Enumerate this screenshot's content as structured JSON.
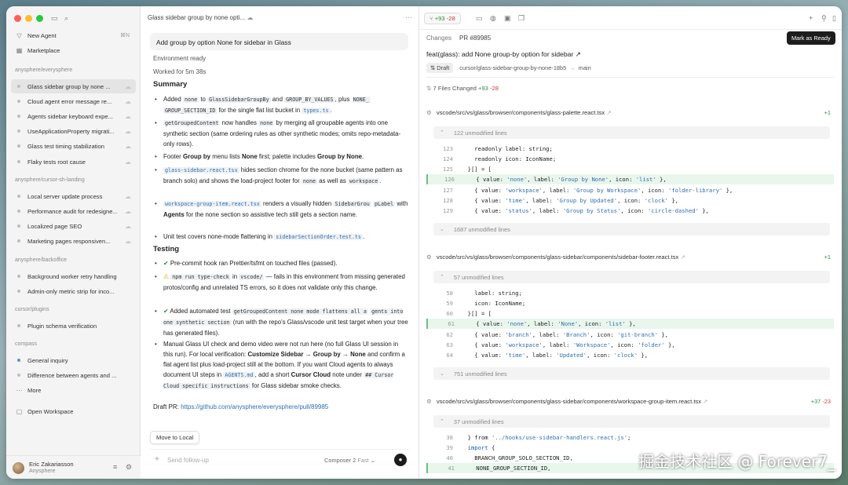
{
  "sidebar": {
    "top": [
      {
        "label": "New Agent",
        "shortcut": "⌘N",
        "icon": "new-agent-icon",
        "glyph": "▽"
      },
      {
        "label": "Marketplace",
        "icon": "marketplace-icon",
        "glyph": "▦"
      }
    ],
    "group1": {
      "name": "anysphere/everysphere",
      "items": [
        "Glass sidebar group by none ...",
        "Cloud agent error message re...",
        "Agents sidebar keyboard expe...",
        "UseApplicationProperty migrati...",
        "Glass test timing stabilization",
        "Flaky tests root cause"
      ]
    },
    "group2": {
      "name": "anysphere/cursor-sh-landing",
      "items": [
        "Local server update process",
        "Performance audit for redesigne...",
        "Localized page SEO",
        "Marketing pages responsiven..."
      ]
    },
    "group3": {
      "name": "anysphere/backoffice",
      "items": [
        "Background worker retry handling",
        "Admin-only metric strip for inco..."
      ]
    },
    "group4": {
      "name": "cursor/plugins",
      "items": [
        "Plugin schema verification"
      ]
    },
    "group5": {
      "name": "compass",
      "items": [
        "General inquiry",
        "Difference between agents and ..."
      ]
    },
    "more": "More",
    "open_workspace": "Open Workspace",
    "user": {
      "name": "Eric Zakariasson",
      "org": "Anysphere"
    }
  },
  "chat": {
    "title": "Glass sidebar group by none opti...",
    "prompt": "Add group by option None for sidebar in Glass",
    "env": "Environment ready",
    "worked": "Worked for 5m 38s",
    "summary_h": "Summary",
    "testing_h": "Testing",
    "draft_label": "Draft PR:",
    "draft_link": "https://github.com/anysphere/everysphere/pull/89985",
    "move_local": "Move to Local",
    "followup": "Send follow-up",
    "model": "Composer 2",
    "speed": "Fast"
  },
  "right": {
    "diff_add": "+93",
    "diff_del": "-28",
    "mark_ready": "Mark as Ready",
    "tab_changes": "Changes",
    "tab_pr": "PR #89985",
    "pr_title": "feat(glass): add None group-by option for sidebar ↗",
    "draft": "Draft",
    "branch": "cursor/glass-sidebar-group-by-none-18b5",
    "base": "main",
    "files_changed": "7 Files Changed",
    "f1": {
      "path": "vscode/src/vs/glass/browser/components/glass-palette.react.tsx",
      "count": "+1",
      "um1": "122 unmodified lines",
      "um2": "1687 unmodified lines"
    },
    "f2": {
      "path": "vscode/src/vs/glass/browser/components/glass-sidebar/components/sidebar-footer.react.tsx",
      "count": "+1",
      "um1": "57 unmodified lines",
      "um2": "751 unmodified lines"
    },
    "f3": {
      "path": "vscode/src/vs/glass/browser/components/glass-sidebar/components/workspace-group-item.react.tsx",
      "add": "+37",
      "del": "-23",
      "um1": "37 unmodified lines"
    }
  },
  "watermark": "掘金技术社区 @ Forever7_"
}
